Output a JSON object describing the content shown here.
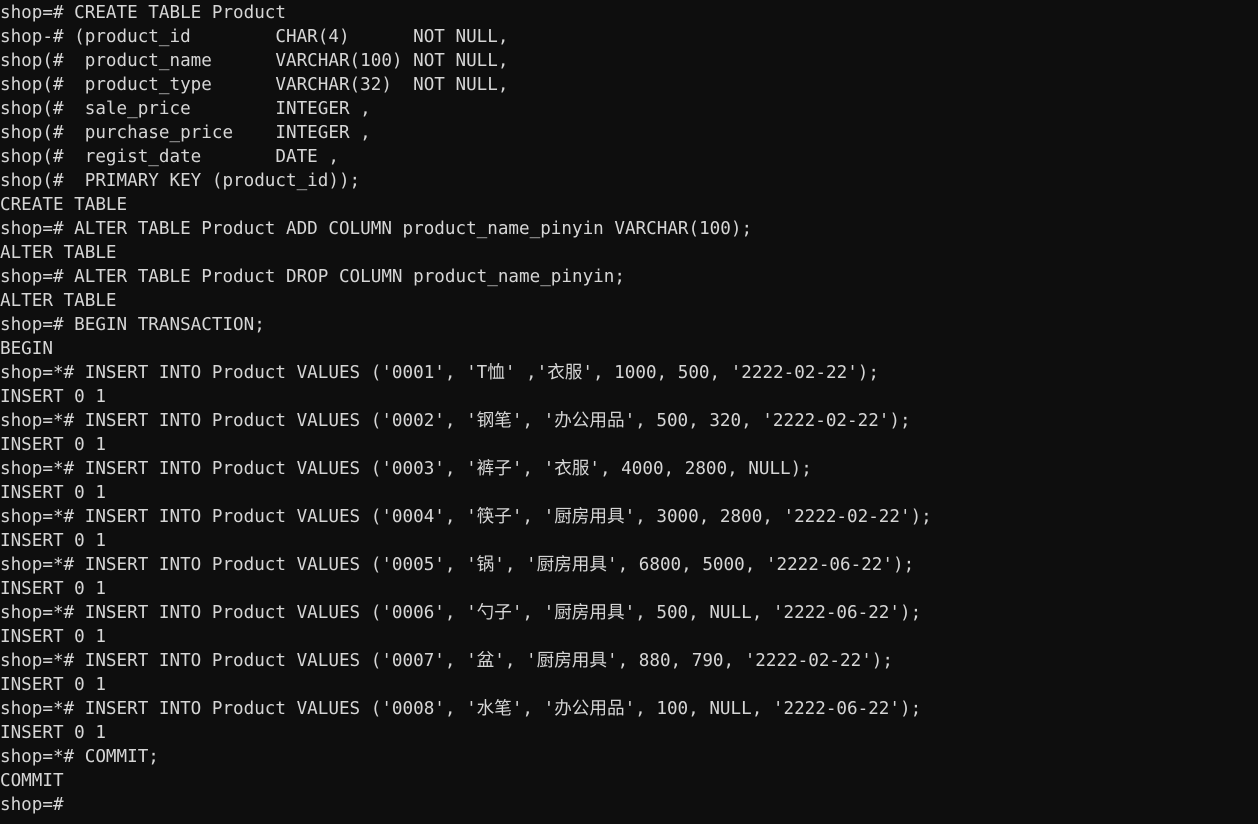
{
  "terminal": {
    "title": "psql-session",
    "prompt_primary": "shop=#",
    "prompt_continuation": "shop(#",
    "prompt_dash": "shop-#",
    "prompt_transaction": "shop=*#",
    "background_color": "#0e0e0e",
    "foreground_color": "#d6d6d6",
    "cursor_visible": false,
    "lines": [
      "shop=# CREATE TABLE Product",
      "shop-# (product_id        CHAR(4)      NOT NULL,",
      "shop(#  product_name      VARCHAR(100) NOT NULL,",
      "shop(#  product_type      VARCHAR(32)  NOT NULL,",
      "shop(#  sale_price        INTEGER ,",
      "shop(#  purchase_price    INTEGER ,",
      "shop(#  regist_date       DATE ,",
      "shop(#  PRIMARY KEY (product_id));",
      "CREATE TABLE",
      "shop=# ALTER TABLE Product ADD COLUMN product_name_pinyin VARCHAR(100);",
      "ALTER TABLE",
      "shop=# ALTER TABLE Product DROP COLUMN product_name_pinyin;",
      "ALTER TABLE",
      "shop=# BEGIN TRANSACTION;",
      "BEGIN",
      "shop=*# INSERT INTO Product VALUES ('0001', 'T恤' ,'衣服', 1000, 500, '2222-02-22');",
      "INSERT 0 1",
      "shop=*# INSERT INTO Product VALUES ('0002', '钢笔', '办公用品', 500, 320, '2222-02-22');",
      "INSERT 0 1",
      "shop=*# INSERT INTO Product VALUES ('0003', '裤子', '衣服', 4000, 2800, NULL);",
      "INSERT 0 1",
      "shop=*# INSERT INTO Product VALUES ('0004', '筷子', '厨房用具', 3000, 2800, '2222-02-22');",
      "INSERT 0 1",
      "shop=*# INSERT INTO Product VALUES ('0005', '锅', '厨房用具', 6800, 5000, '2222-06-22');",
      "INSERT 0 1",
      "shop=*# INSERT INTO Product VALUES ('0006', '勺子', '厨房用具', 500, NULL, '2222-06-22');",
      "INSERT 0 1",
      "shop=*# INSERT INTO Product VALUES ('0007', '盆', '厨房用具', 880, 790, '2222-02-22');",
      "INSERT 0 1",
      "shop=*# INSERT INTO Product VALUES ('0008', '水笔', '办公用品', 100, NULL, '2222-06-22');",
      "INSERT 0 1",
      "shop=*# COMMIT;",
      "COMMIT",
      "shop=#"
    ],
    "products": [
      {
        "product_id": "0001",
        "product_name": "T恤",
        "product_type": "衣服",
        "sale_price": 1000,
        "purchase_price": 500,
        "regist_date": "2222-02-22"
      },
      {
        "product_id": "0002",
        "product_name": "钢笔",
        "product_type": "办公用品",
        "sale_price": 500,
        "purchase_price": 320,
        "regist_date": "2222-02-22"
      },
      {
        "product_id": "0003",
        "product_name": "裤子",
        "product_type": "衣服",
        "sale_price": 4000,
        "purchase_price": 2800,
        "regist_date": "NULL"
      },
      {
        "product_id": "0004",
        "product_name": "筷子",
        "product_type": "厨房用具",
        "sale_price": 3000,
        "purchase_price": 2800,
        "regist_date": "2222-02-22"
      },
      {
        "product_id": "0005",
        "product_name": "锅",
        "product_type": "厨房用具",
        "sale_price": 6800,
        "purchase_price": 5000,
        "regist_date": "2222-06-22"
      },
      {
        "product_id": "0006",
        "product_name": "勺子",
        "product_type": "厨房用具",
        "sale_price": 500,
        "purchase_price": "NULL",
        "regist_date": "2222-06-22"
      },
      {
        "product_id": "0007",
        "product_name": "盆",
        "product_type": "厨房用具",
        "sale_price": 880,
        "purchase_price": 790,
        "regist_date": "2222-02-22"
      },
      {
        "product_id": "0008",
        "product_name": "水笔",
        "product_type": "办公用品",
        "sale_price": 100,
        "purchase_price": "NULL",
        "regist_date": "2222-06-22"
      }
    ],
    "schema": {
      "table_name": "Product",
      "columns": [
        {
          "name": "product_id",
          "type": "CHAR(4)",
          "constraint": "NOT NULL"
        },
        {
          "name": "product_name",
          "type": "VARCHAR(100)",
          "constraint": "NOT NULL"
        },
        {
          "name": "product_type",
          "type": "VARCHAR(32)",
          "constraint": "NOT NULL"
        },
        {
          "name": "sale_price",
          "type": "INTEGER",
          "constraint": ""
        },
        {
          "name": "purchase_price",
          "type": "INTEGER",
          "constraint": ""
        },
        {
          "name": "regist_date",
          "type": "DATE",
          "constraint": ""
        }
      ],
      "primary_key": "product_id"
    },
    "results": {
      "create_table": "CREATE TABLE",
      "alter_table": "ALTER TABLE",
      "begin": "BEGIN",
      "insert": "INSERT 0 1",
      "commit": "COMMIT"
    }
  }
}
